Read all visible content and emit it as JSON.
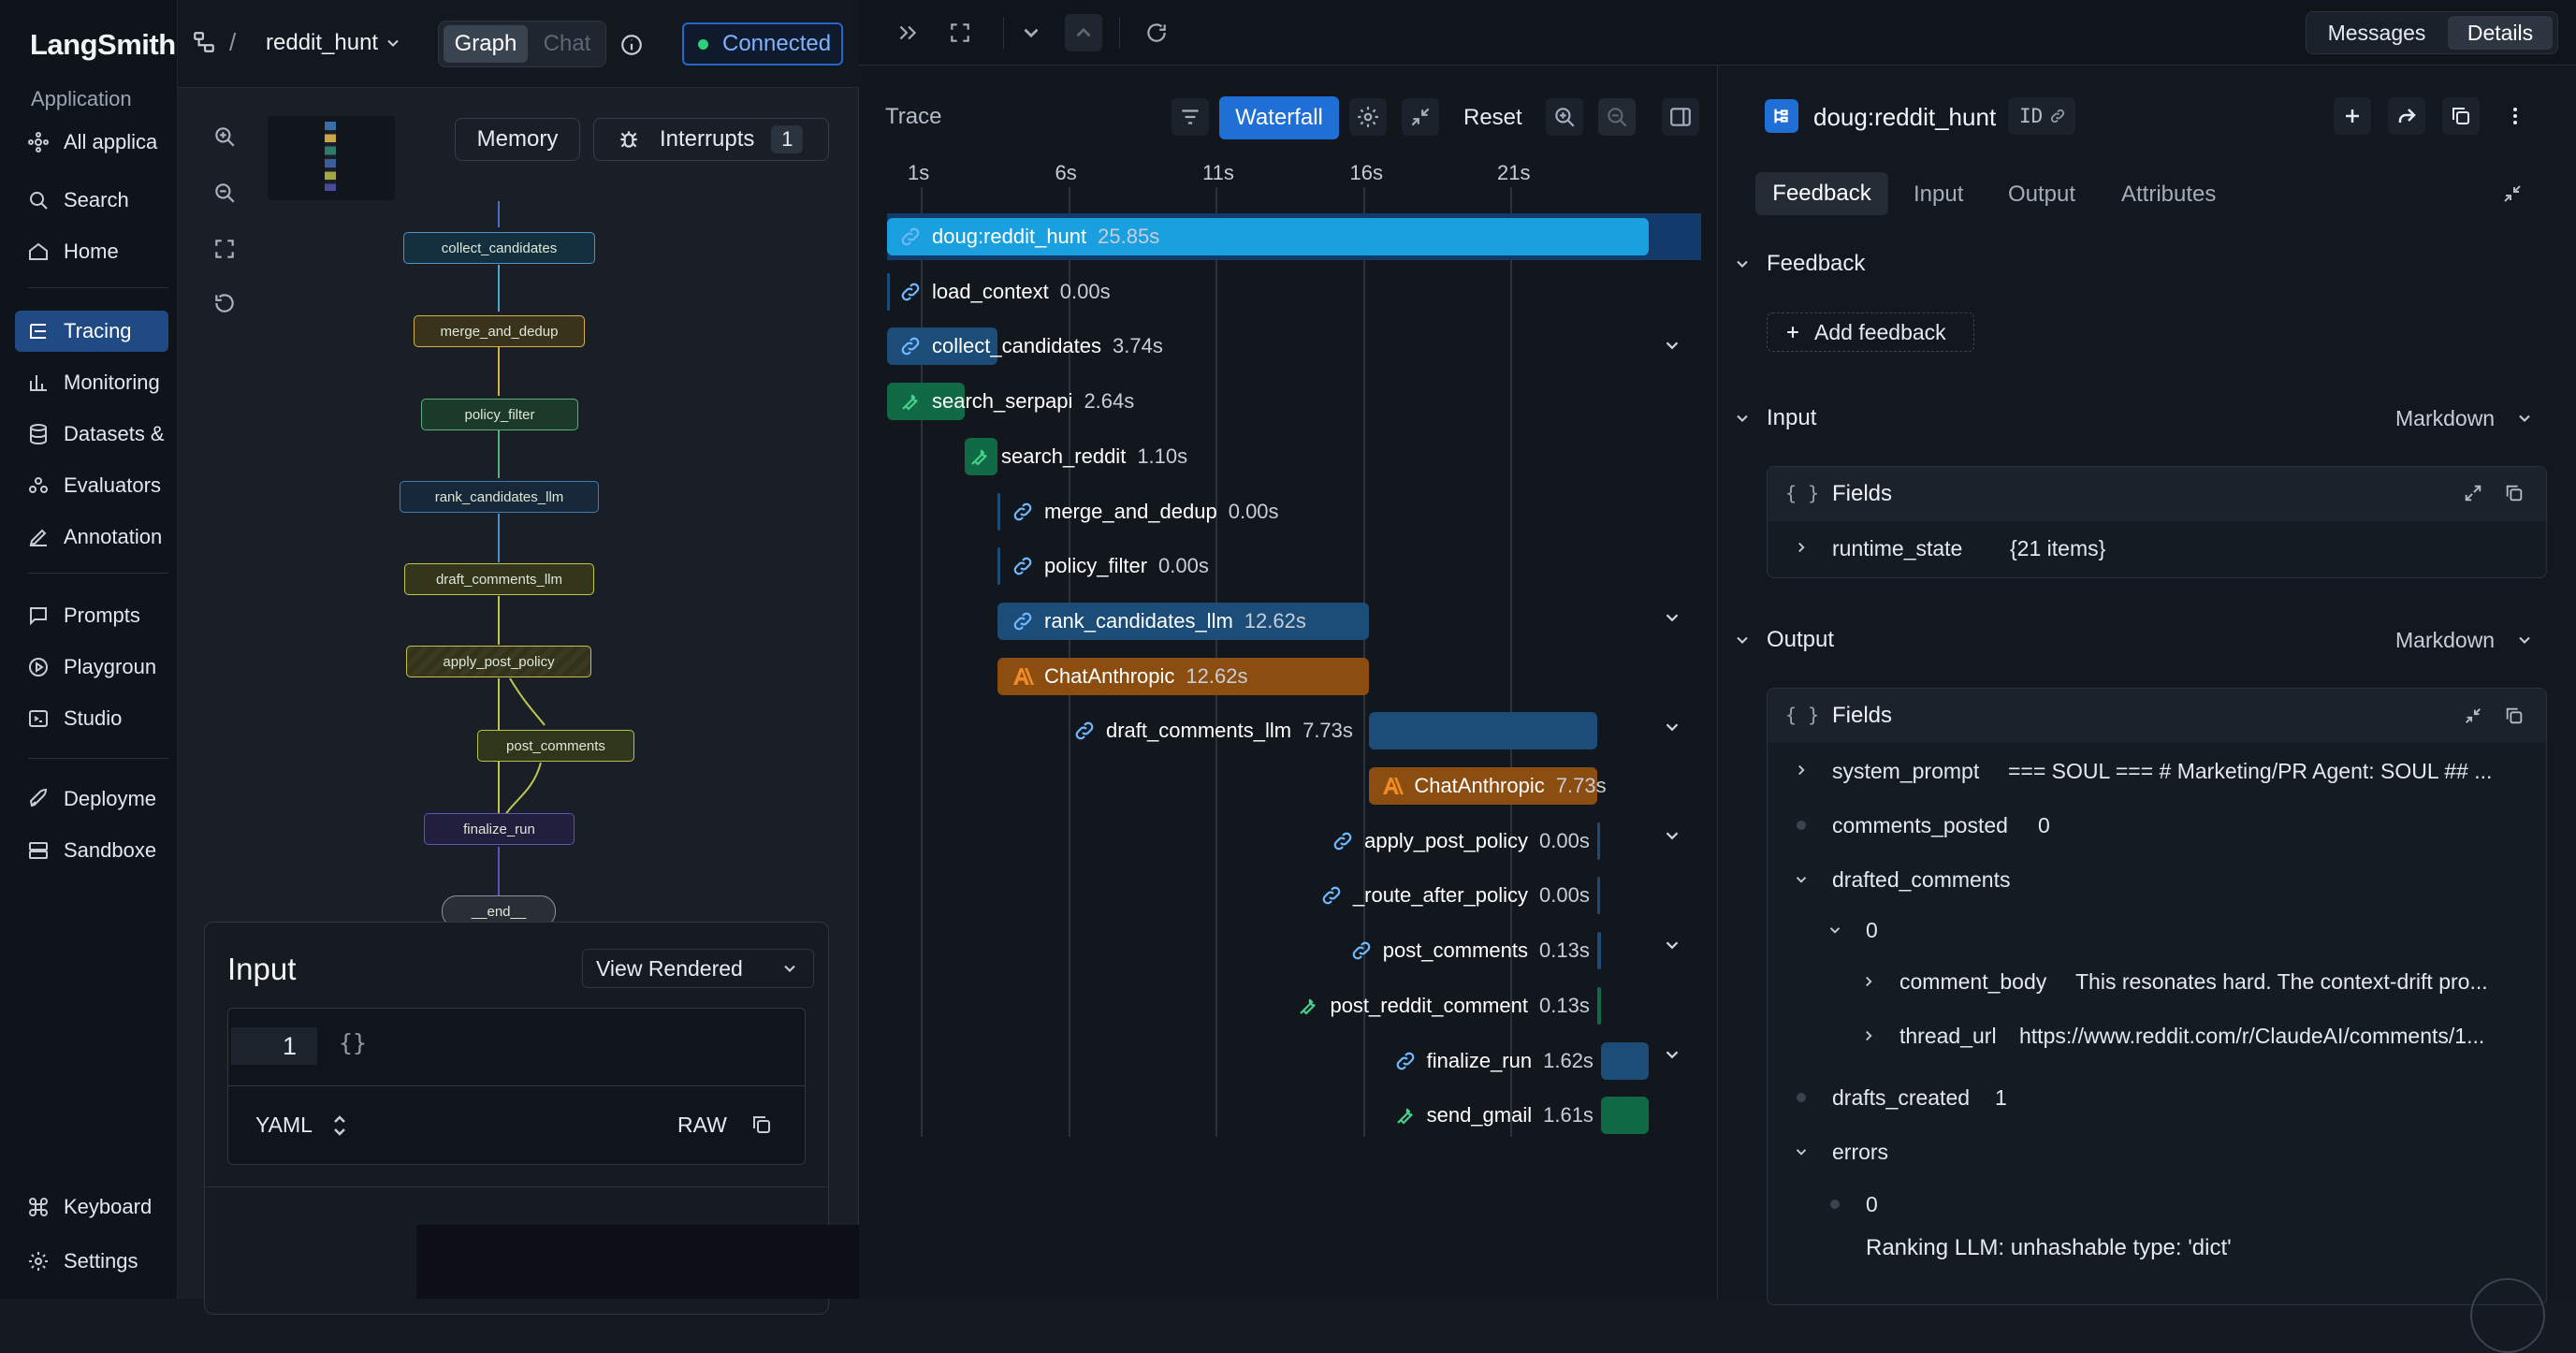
{
  "app": {
    "brand": "LangSmith",
    "section_label": "Application",
    "nav": [
      {
        "label": "All applica",
        "icon": "apps-icon"
      },
      {
        "label": "Search",
        "icon": "search-icon"
      },
      {
        "label": "Home",
        "icon": "home-icon"
      },
      {
        "label": "Tracing",
        "icon": "tracing-icon"
      },
      {
        "label": "Monitoring",
        "icon": "chart-icon"
      },
      {
        "label": "Datasets &",
        "icon": "database-icon"
      },
      {
        "label": "Evaluators",
        "icon": "evaluator-icon"
      },
      {
        "label": "Annotation",
        "icon": "pen-icon"
      },
      {
        "label": "Prompts",
        "icon": "prompt-icon"
      },
      {
        "label": "Playgroun",
        "icon": "play-icon"
      },
      {
        "label": "Studio",
        "icon": "studio-icon"
      },
      {
        "label": "Deployme",
        "icon": "rocket-icon"
      },
      {
        "label": "Sandboxe",
        "icon": "sandbox-icon"
      },
      {
        "label": "Keyboard",
        "icon": "command-icon"
      },
      {
        "label": "Settings",
        "icon": "gear-icon"
      }
    ]
  },
  "graph": {
    "breadcrumb_sep": "/",
    "project": "reddit_hunt",
    "tab_graph": "Graph",
    "tab_chat": "Chat",
    "status": "Connected",
    "memory_label": "Memory",
    "interrupts_label": "Interrupts",
    "interrupts_count": "1",
    "nodes": [
      "collect_candidates",
      "merge_and_dedup",
      "policy_filter",
      "rank_candidates_llm",
      "draft_comments_llm",
      "apply_post_policy",
      "post_comments",
      "finalize_run",
      "__end__"
    ]
  },
  "input_panel": {
    "title": "Input",
    "view_mode": "View Rendered",
    "line_number": "1",
    "code": "{}",
    "format": "YAML",
    "raw_label": "RAW"
  },
  "trace": {
    "title": "Trace",
    "view": "Waterfall",
    "reset": "Reset",
    "ticks": [
      "1s",
      "6s",
      "11s",
      "16s",
      "21s"
    ],
    "rows": [
      {
        "name": "doug:reddit_hunt",
        "dur": "25.85s",
        "kind": "chain",
        "start": 0,
        "end": 25.85
      },
      {
        "name": "load_context",
        "dur": "0.00s",
        "kind": "chain",
        "start": 0,
        "end": 0
      },
      {
        "name": "collect_candidates",
        "dur": "3.74s",
        "kind": "chain",
        "start": 0,
        "end": 3.74
      },
      {
        "name": "search_serpapi",
        "dur": "2.64s",
        "kind": "tool",
        "start": 0,
        "end": 2.64
      },
      {
        "name": "search_reddit",
        "dur": "1.10s",
        "kind": "tool",
        "start": 2.64,
        "end": 3.74
      },
      {
        "name": "merge_and_dedup",
        "dur": "0.00s",
        "kind": "chain",
        "start": 3.74,
        "end": 3.74
      },
      {
        "name": "policy_filter",
        "dur": "0.00s",
        "kind": "chain",
        "start": 3.74,
        "end": 3.74
      },
      {
        "name": "rank_candidates_llm",
        "dur": "12.62s",
        "kind": "chain",
        "start": 3.74,
        "end": 16.36
      },
      {
        "name": "ChatAnthropic",
        "dur": "12.62s",
        "kind": "llm",
        "start": 3.74,
        "end": 16.36
      },
      {
        "name": "draft_comments_llm",
        "dur": "7.73s",
        "kind": "chain",
        "start": 16.36,
        "end": 24.09
      },
      {
        "name": "ChatAnthropic",
        "dur": "7.73s",
        "kind": "llm",
        "start": 16.36,
        "end": 24.09
      },
      {
        "name": "apply_post_policy",
        "dur": "0.00s",
        "kind": "chain",
        "start": 24.09,
        "end": 24.09
      },
      {
        "name": "_route_after_policy",
        "dur": "0.00s",
        "kind": "chain",
        "start": 24.09,
        "end": 24.09
      },
      {
        "name": "post_comments",
        "dur": "0.13s",
        "kind": "chain",
        "start": 24.09,
        "end": 24.22
      },
      {
        "name": "post_reddit_comment",
        "dur": "0.13s",
        "kind": "tool",
        "start": 24.09,
        "end": 24.22
      },
      {
        "name": "finalize_run",
        "dur": "1.62s",
        "kind": "chain",
        "start": 24.22,
        "end": 25.84
      },
      {
        "name": "send_gmail",
        "dur": "1.61s",
        "kind": "tool",
        "start": 24.22,
        "end": 25.83
      }
    ]
  },
  "details": {
    "view_messages": "Messages",
    "view_details": "Details",
    "run_name": "doug:reddit_hunt",
    "id_label": "ID",
    "tabs": [
      "Feedback",
      "Input",
      "Output",
      "Attributes"
    ],
    "feedback_title": "Feedback",
    "add_feedback": "Add feedback",
    "input_title": "Input",
    "output_title": "Output",
    "format": "Markdown",
    "fields_label": "Fields",
    "input_fields": [
      {
        "key": "runtime_state",
        "value": "{21 items}"
      }
    ],
    "output_fields": {
      "system_prompt": {
        "key": "system_prompt",
        "value": "=== SOUL === # Marketing/PR Agent: SOUL ## ..."
      },
      "comments_posted": {
        "key": "comments_posted",
        "value": "0"
      },
      "drafted_comments": {
        "key": "drafted_comments",
        "index": "0"
      },
      "comment_body": {
        "key": "comment_body",
        "value": "This resonates hard. The context-drift pro..."
      },
      "thread_url": {
        "key": "thread_url",
        "value": "https://www.reddit.com/r/ClaudeAI/comments/1..."
      },
      "drafts_created": {
        "key": "drafts_created",
        "value": "1"
      },
      "errors": {
        "key": "errors",
        "index": "0",
        "message": "Ranking LLM: unhashable type: 'dict'"
      }
    }
  },
  "colors": {
    "accent": "#1f6fd6",
    "chain_bar": "#1b4d78",
    "root_bar": "#1aa0de",
    "tool_bar": "#0f6a45",
    "llm_bar": "#8c4d10",
    "connected": "#2bd07a"
  }
}
